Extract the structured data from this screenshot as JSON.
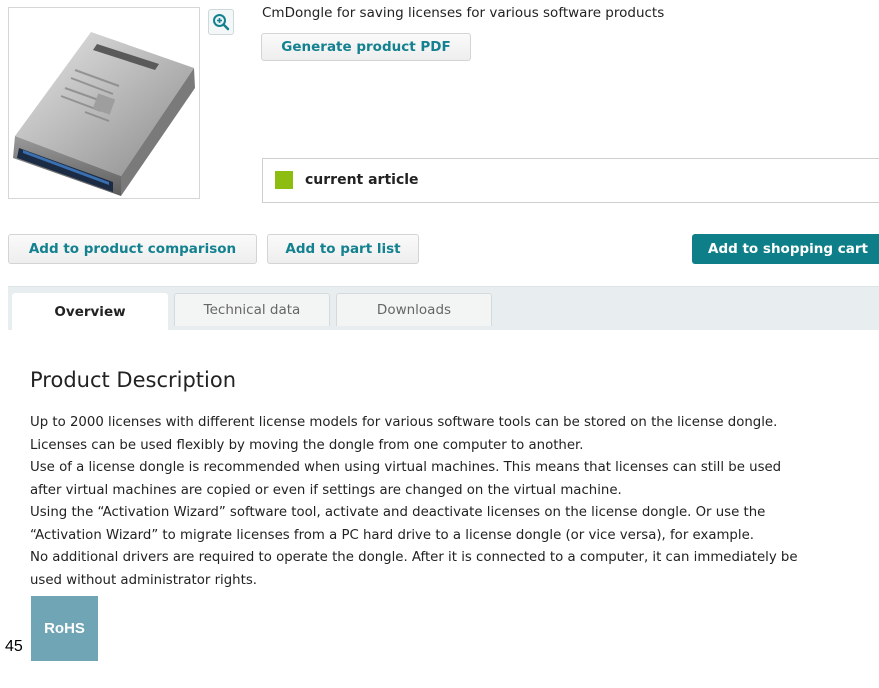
{
  "product": {
    "short_description": "CmDongle for saving licenses for various software products",
    "image_alt": "license dongle",
    "zoom_icon": "zoom-in-icon"
  },
  "buttons": {
    "generate_pdf": "Generate product PDF",
    "add_to_comparison": "Add to product comparison",
    "add_to_part_list": "Add to part list",
    "add_to_cart": "Add to shopping cart"
  },
  "status": {
    "label": "current article",
    "color": "#8dbd10"
  },
  "tabs": [
    {
      "label": "Overview",
      "active": true
    },
    {
      "label": "Technical data",
      "active": false
    },
    {
      "label": "Downloads",
      "active": false
    }
  ],
  "description": {
    "title": "Product Description",
    "lines": [
      "Up to 2000 licenses with different license models for various software tools can be stored on the license dongle.",
      "Licenses can be used flexibly by moving the dongle from one computer to another.",
      "Use of a license dongle is recommended when using virtual machines. This means that licenses can still be used",
      "after virtual machines are copied or even if settings are changed on the virtual machine.",
      "Using the “Activation Wizard” software tool, activate and deactivate licenses on the license dongle. Or use the",
      "“Activation Wizard” to migrate licenses from a PC hard drive to a license dongle (or vice versa), for example.",
      "No additional drivers are required to operate the dongle. After it is connected to a computer, it can immediately be",
      "used without administrator rights."
    ]
  },
  "badge": {
    "label": "RoHS"
  },
  "page_number": "45",
  "colors": {
    "accent": "#13818f",
    "cart_button": "#0e7f89",
    "rohs_badge": "#6fa5b5"
  }
}
